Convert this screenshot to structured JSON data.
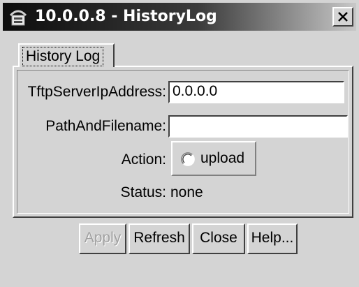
{
  "window": {
    "title": "10.0.0.8 - HistoryLog",
    "app_icon": "network-device-icon",
    "close_icon": "close-icon"
  },
  "tabs": [
    {
      "label": "History Log",
      "selected": true
    }
  ],
  "form": {
    "tftp_label": "TftpServerIpAddress:",
    "tftp_value": "0.0.0.0",
    "path_label": "PathAndFilename:",
    "path_value": "",
    "action_label": "Action:",
    "action_option": "upload",
    "action_selected": false,
    "status_label": "Status:",
    "status_value": "none"
  },
  "buttons": {
    "apply": "Apply",
    "refresh": "Refresh",
    "close": "Close",
    "help": "Help..."
  }
}
